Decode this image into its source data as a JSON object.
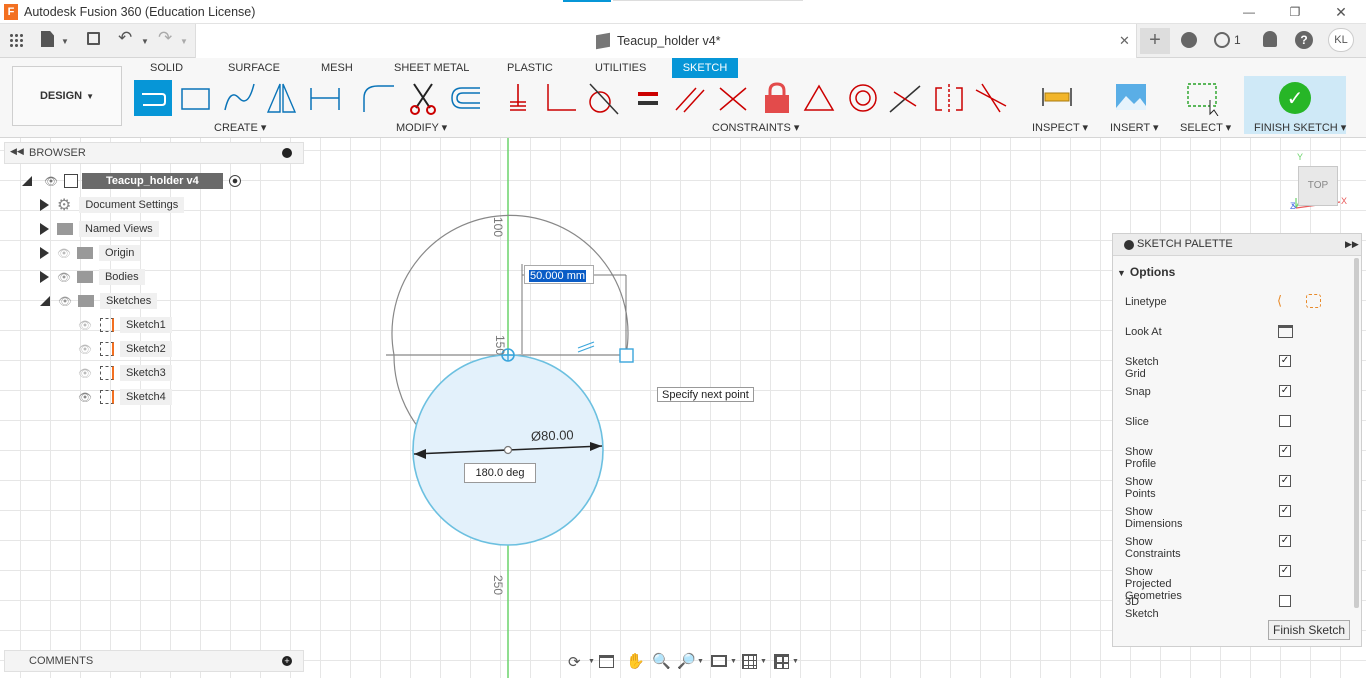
{
  "app": {
    "title": "Autodesk Fusion 360 (Education License)",
    "document_title": "Teacup_holder v4*",
    "user_initials": "KL",
    "job_count": "1"
  },
  "workspace": {
    "label": "DESIGN"
  },
  "tabs": [
    "SOLID",
    "SURFACE",
    "MESH",
    "SHEET METAL",
    "PLASTIC",
    "UTILITIES",
    "SKETCH"
  ],
  "groups": {
    "create": "CREATE",
    "modify": "MODIFY",
    "constraints": "CONSTRAINTS",
    "inspect": "INSPECT",
    "insert": "INSERT",
    "select": "SELECT",
    "finish": "FINISH SKETCH"
  },
  "browser": {
    "title": "BROWSER",
    "root": "Teacup_holder v4",
    "items": [
      "Document Settings",
      "Named Views",
      "Origin",
      "Bodies",
      "Sketches"
    ],
    "sketches": [
      "Sketch1",
      "Sketch2",
      "Sketch3",
      "Sketch4"
    ]
  },
  "comments": {
    "title": "COMMENTS"
  },
  "canvas": {
    "ruler_labels": [
      "100",
      "150",
      "250"
    ],
    "dimension_input": "50.000 mm",
    "diameter_label": "Ø80.00",
    "angle_label": "180.0 deg",
    "tooltip": "Specify next point",
    "viewcube": "TOP",
    "axis_y": "Y",
    "axis_x": "X",
    "axis_z": "Z"
  },
  "palette": {
    "title": "SKETCH PALETTE",
    "section": "Options",
    "linetype": "Linetype",
    "look_at": "Look At",
    "options": [
      {
        "label": "Sketch Grid",
        "checked": true
      },
      {
        "label": "Snap",
        "checked": true
      },
      {
        "label": "Slice",
        "checked": false
      },
      {
        "label": "Show Profile",
        "checked": true
      },
      {
        "label": "Show Points",
        "checked": true
      },
      {
        "label": "Show Dimensions",
        "checked": true
      },
      {
        "label": "Show Constraints",
        "checked": true
      },
      {
        "label": "Show Projected Geometries",
        "checked": true
      },
      {
        "label": "3D Sketch",
        "checked": false
      }
    ],
    "finish_button": "Finish Sketch"
  },
  "colors": {
    "accent": "#0696d7",
    "finish": "#27b627",
    "profile_fill": "#e3f1fb",
    "profile_stroke": "#6cc0e0"
  }
}
